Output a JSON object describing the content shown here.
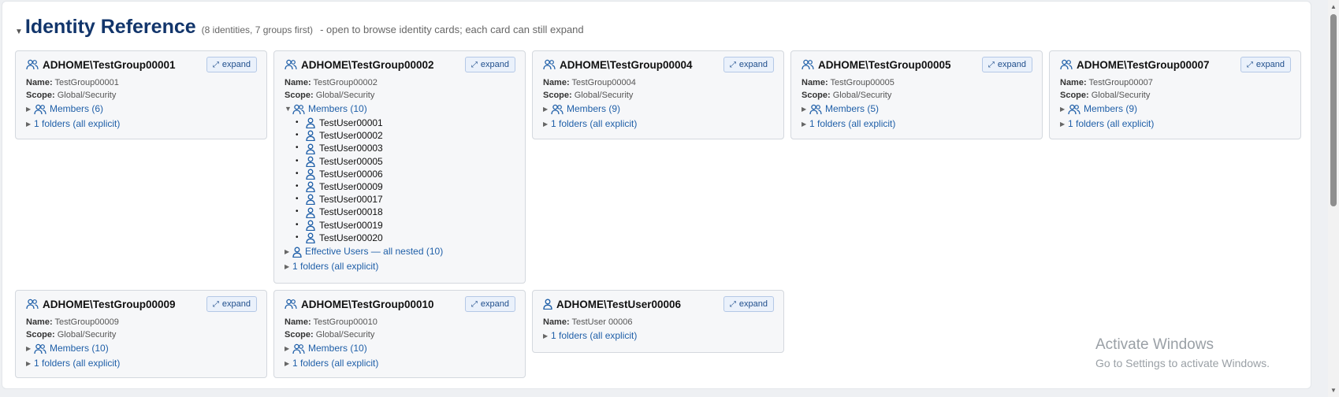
{
  "header": {
    "title": "Identity Reference",
    "count": "(8 identities, 7 groups first)",
    "hint": "- open to browse identity cards; each card can still expand"
  },
  "expand_label": "expand",
  "name_label": "Name:",
  "scope_label": "Scope:",
  "cards": [
    {
      "title": "ADHOME\\TestGroup00001",
      "name": "TestGroup00001",
      "scope": "Global/Security",
      "members": "Members (6)",
      "folders": "1 folders (all explicit)"
    },
    {
      "title": "ADHOME\\TestGroup00002",
      "name": "TestGroup00002",
      "scope": "Global/Security",
      "members": "Members (10)",
      "folders": "1 folders (all explicit)",
      "member_list": [
        "TestUser00001",
        "TestUser00002",
        "TestUser00003",
        "TestUser00005",
        "TestUser00006",
        "TestUser00009",
        "TestUser00017",
        "TestUser00018",
        "TestUser00019",
        "TestUser00020"
      ],
      "effective": "Effective Users — all nested (10)"
    },
    {
      "title": "ADHOME\\TestGroup00004",
      "name": "TestGroup00004",
      "scope": "Global/Security",
      "members": "Members (9)",
      "folders": "1 folders (all explicit)"
    },
    {
      "title": "ADHOME\\TestGroup00005",
      "name": "TestGroup00005",
      "scope": "Global/Security",
      "members": "Members (5)",
      "folders": "1 folders (all explicit)"
    },
    {
      "title": "ADHOME\\TestGroup00007",
      "name": "TestGroup00007",
      "scope": "Global/Security",
      "members": "Members (9)",
      "folders": "1 folders (all explicit)"
    },
    {
      "title": "ADHOME\\TestGroup00009",
      "name": "TestGroup00009",
      "scope": "Global/Security",
      "members": "Members (10)",
      "folders": "1 folders (all explicit)"
    },
    {
      "title": "ADHOME\\TestGroup00010",
      "name": "TestGroup00010",
      "scope": "Global/Security",
      "members": "Members (10)",
      "folders": "1 folders (all explicit)"
    },
    {
      "title": "ADHOME\\TestUser00006",
      "name": "TestUser 00006",
      "folders": "1 folders (all explicit)"
    }
  ],
  "watermark": {
    "line1": "Activate Windows",
    "line2": "Go to Settings to activate Windows."
  },
  "colors": {
    "title": "#12356b",
    "link": "#1f5fa8",
    "icon": "#1f5fa8",
    "card_bg": "#f6f7f9"
  },
  "icons": {
    "group": "group-icon",
    "user": "user-icon",
    "expand": "expand-arrows-icon"
  }
}
